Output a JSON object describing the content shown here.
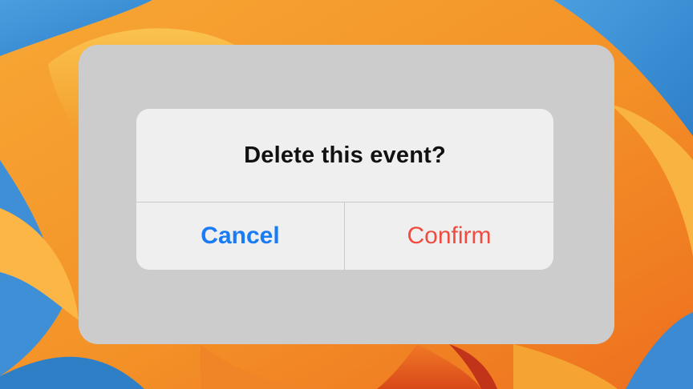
{
  "dialog": {
    "title": "Delete this event?",
    "cancel_label": "Cancel",
    "confirm_label": "Confirm"
  },
  "colors": {
    "cancel": "#1a7cf5",
    "confirm": "#ef4b3f",
    "title": "#111111",
    "dialog_background": "#efefef",
    "overlay_background": "#cccccc"
  }
}
